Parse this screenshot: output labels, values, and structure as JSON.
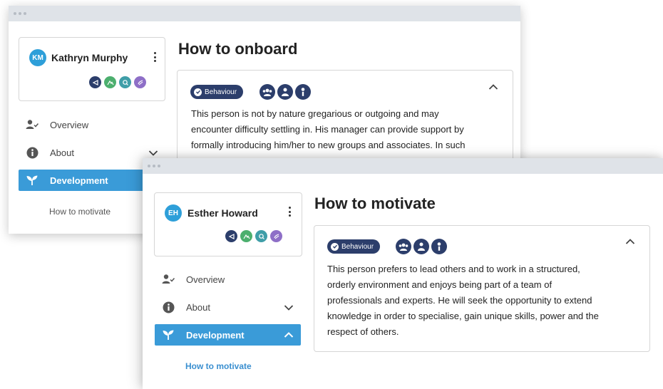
{
  "back_window": {
    "user": {
      "initials": "KM",
      "name": "Kathryn Murphy"
    },
    "nav": {
      "overview": "Overview",
      "about": "About",
      "development": "Development",
      "sub_item": "How to motivate"
    },
    "page_title": "How to onboard",
    "tag_label": "Behaviour",
    "body_lines": [
      "This person is not by nature gregarious or outgoing and may",
      "encounter difficulty settling in. His manager can provide  support by",
      "formally introducing him/her to new groups and associates. In such"
    ]
  },
  "front_window": {
    "user": {
      "initials": "EH",
      "name": "Esther Howard"
    },
    "nav": {
      "overview": "Overview",
      "about": "About",
      "development": "Development",
      "sub_item": "How to motivate"
    },
    "page_title": "How to motivate",
    "tag_label": "Behaviour",
    "body_lines": [
      "This person prefers to lead others and to work in a structured,",
      "orderly environment and enjoys being part of a team of",
      "professionals  and experts. He will seek the opportunity to extend",
      "knowledge in order to specialise, gain unique skills, power and the",
      "respect of others."
    ]
  },
  "icons": {
    "profile_badges": [
      "send-icon",
      "mountain-icon",
      "search-icon",
      "hand-icon"
    ],
    "trait_icons": [
      "team-icon",
      "person-check-icon",
      "person-info-icon"
    ],
    "nav_icons": [
      "user-check-icon",
      "info-icon",
      "sprout-icon"
    ]
  },
  "colors": {
    "accent_blue": "#3a9bd8",
    "navy": "#2c3e6b",
    "badge_green": "#4caf6e",
    "badge_teal": "#3f9ea8",
    "badge_purple": "#8e6fc7"
  }
}
